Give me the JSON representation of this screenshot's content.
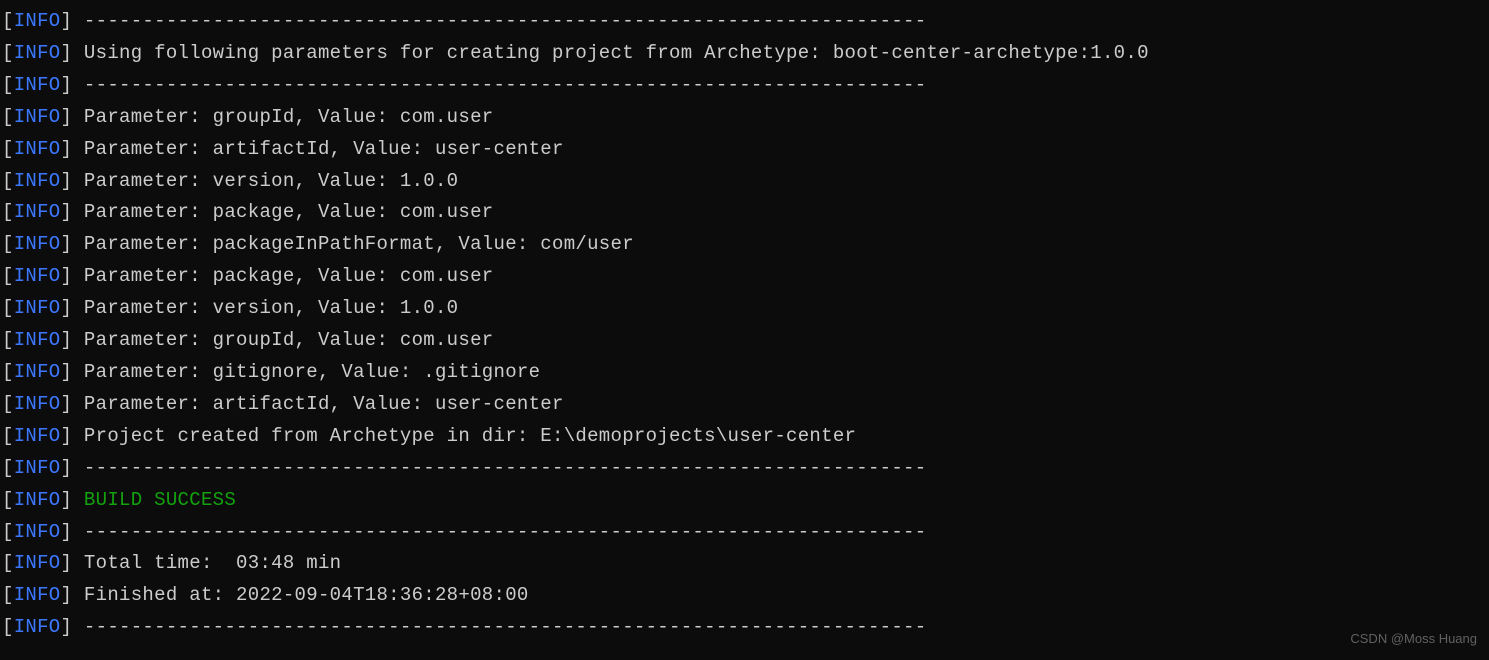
{
  "log": {
    "level_label": "INFO",
    "separator": "------------------------------------------------------------------------",
    "lines": [
      {
        "type": "sep"
      },
      {
        "type": "msg",
        "text": "Using following parameters for creating project from Archetype: boot-center-archetype:1.0.0"
      },
      {
        "type": "sep"
      },
      {
        "type": "msg",
        "text": "Parameter: groupId, Value: com.user"
      },
      {
        "type": "msg",
        "text": "Parameter: artifactId, Value: user-center"
      },
      {
        "type": "msg",
        "text": "Parameter: version, Value: 1.0.0"
      },
      {
        "type": "msg",
        "text": "Parameter: package, Value: com.user"
      },
      {
        "type": "msg",
        "text": "Parameter: packageInPathFormat, Value: com/user"
      },
      {
        "type": "msg",
        "text": "Parameter: package, Value: com.user"
      },
      {
        "type": "msg",
        "text": "Parameter: version, Value: 1.0.0"
      },
      {
        "type": "msg",
        "text": "Parameter: groupId, Value: com.user"
      },
      {
        "type": "msg",
        "text": "Parameter: gitignore, Value: .gitignore"
      },
      {
        "type": "msg",
        "text": "Parameter: artifactId, Value: user-center"
      },
      {
        "type": "msg",
        "text": "Project created from Archetype in dir: E:\\demoprojects\\user-center"
      },
      {
        "type": "sep"
      },
      {
        "type": "success",
        "text": "BUILD SUCCESS"
      },
      {
        "type": "sep"
      },
      {
        "type": "msg",
        "text": "Total time:  03:48 min"
      },
      {
        "type": "msg",
        "text": "Finished at: 2022-09-04T18:36:28+08:00"
      },
      {
        "type": "sep"
      }
    ]
  },
  "watermark": "CSDN @Moss Huang"
}
